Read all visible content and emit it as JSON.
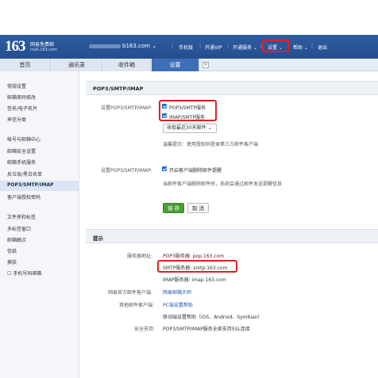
{
  "header": {
    "logo_number": "163",
    "logo_name": "网易免费邮",
    "logo_domain": "mail.163.com",
    "account_suffix": "b163.com",
    "nav": [
      "手机版",
      "开通VIP",
      "开通服务",
      "设置",
      "帮助",
      "退出"
    ]
  },
  "tabs": [
    {
      "label": "首页"
    },
    {
      "label": "通讯录"
    },
    {
      "label": "收件箱"
    },
    {
      "label": "设置"
    }
  ],
  "sidebar": {
    "items": [
      "常规设置",
      "邮箱密码修改",
      "签名/电子名片",
      "来信分类",
      "帐号与邮箱中心",
      "邮箱安全设置",
      "邮箱手机服务",
      "反垃圾/黑白名单",
      "POP3/SMTP/IMAP",
      "客户端授权密码",
      "文件夹和标签",
      "多标签窗口",
      "邮箱触点",
      "信纸",
      "换肤",
      "手机号码邮箱"
    ]
  },
  "section1": {
    "title": "POP3/SMTP/IMAP",
    "label_enable": "设置POP3/SMTP/IMAP:",
    "cb_pop3": "POP3/SMTP服务",
    "cb_imap": "IMAP/SMTP服务",
    "select_value": "收取最近30天邮件",
    "hint": "温馨提示：使用授权码登录第三方邮件客户端",
    "label_delete": "设置POP3/SMTP/IMAP:",
    "cb_delete": "开启客户端删除邮件提醒",
    "delete_hint": "当邮件客户端删除邮件时，系统会通过邮件发送提醒信息",
    "save": "保 存",
    "cancel": "取 消"
  },
  "section2": {
    "title": "提示",
    "label_server": "服务器地址:",
    "pop3": "POP3服务器: pop.163.com",
    "smtp": "SMTP服务器: smtp.163.com",
    "imap": "IMAP服务器: imap.163.com",
    "label_official": "网易官方邮件客户端:",
    "official": "网易邮箱大师",
    "label_other": "其他邮件客户端:",
    "pc_help": "PC端设置帮助",
    "mobile_help": "移动端设置帮助（iOS、Android、Symbian）",
    "label_security": "安全支持:",
    "security": "POP3/SMTP/IMAP服务全部支持SSL连接"
  }
}
